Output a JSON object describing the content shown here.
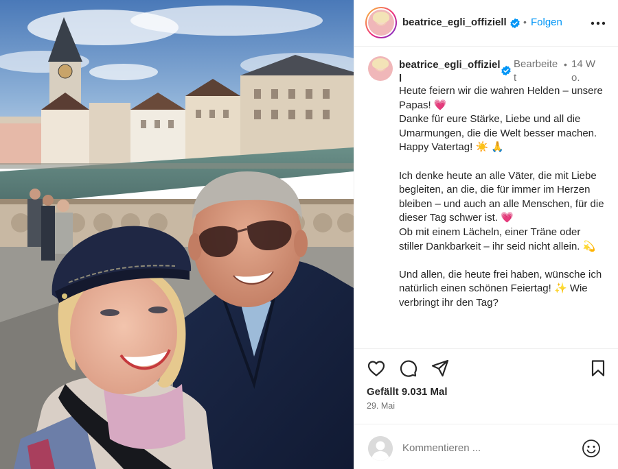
{
  "post": {
    "username": "beatrice_egli_offiziell",
    "follow_label": "Folgen",
    "header_separator": "•"
  },
  "caption": {
    "username": "beatrice_egli_offiziell",
    "edited_label": "Bearbeitet",
    "separator": "•",
    "time": "14 Wo.",
    "text": "Heute feiern wir die wahren Helden – unsere Papas! 💗\nDanke für eure Stärke, Liebe und all die Umarmungen, die die Welt besser machen. Happy Vatertag! ☀️ 🙏\n\nIch denke heute an alle Väter, die mit Liebe begleiten, an die, die für immer im Herzen bleiben – und auch an alle Menschen, für die dieser Tag schwer ist. 💗\nOb mit einem Lächeln, einer Träne oder stiller Dankbarkeit – ihr seid nicht allein. 💫\n\nUnd allen, die heute frei haben, wünsche ich natürlich einen schönen Feiertag! ✨ Wie verbringt ihr den Tag?"
  },
  "actions": {
    "likes": "Gefällt 9.031 Mal",
    "date": "29. Mai",
    "icons": [
      "heart-icon",
      "comment-icon",
      "share-icon",
      "bookmark-icon"
    ]
  },
  "comment_box": {
    "placeholder": "Kommentieren ..."
  },
  "colors": {
    "link_blue": "#0095f6",
    "verified_blue": "#0095f6",
    "text": "#262626",
    "muted": "#737373"
  }
}
